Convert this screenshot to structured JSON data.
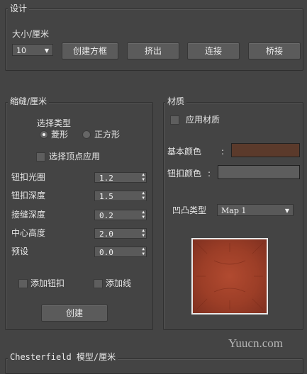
{
  "design": {
    "title": "设计",
    "size_label": "大小/厘米",
    "size_value": "10",
    "buttons": [
      "创建方框",
      "挤出",
      "连接",
      "桥接"
    ]
  },
  "seam": {
    "title": "缩缝/厘米",
    "select_type_label": "选择类型",
    "radio_diamond": "菱形",
    "radio_square": "正方形",
    "selected_type": "菱形",
    "vertex_apply_label": "选择顶点应用",
    "fields": [
      {
        "label": "钮扣光圈",
        "value": "1.2"
      },
      {
        "label": "钮扣深度",
        "value": "1.5"
      },
      {
        "label": "接缝深度",
        "value": "0.2"
      },
      {
        "label": "中心高度",
        "value": "2.0"
      },
      {
        "label": "预设",
        "value": "0.0"
      }
    ],
    "add_button_label": "添加钮扣",
    "add_line_label": "添加线",
    "create_label": "创建"
  },
  "material": {
    "title": "材质",
    "apply_label": "应用材质",
    "base_color_label": "基本颜色",
    "base_color": "#5b3a2b",
    "button_color_label": "钮扣颜色",
    "button_color": "#5d5d5d",
    "colon": ":",
    "bump_label": "凹凸类型",
    "bump_value": "Map 1",
    "preview_color": "#a8432b"
  },
  "bottom": {
    "title": "Chesterfield 模型/厘米"
  },
  "watermark": "Yuucn.com"
}
